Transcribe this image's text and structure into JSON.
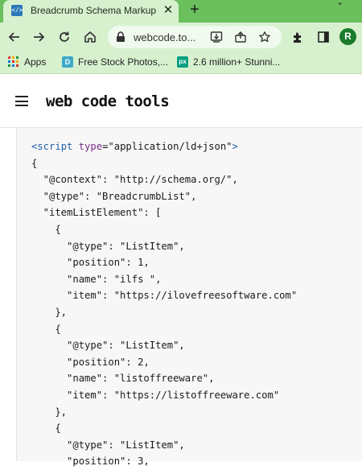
{
  "browser": {
    "tab": {
      "title": "Breadcrumb Schema Markup",
      "favicon_text": "</>"
    },
    "new_tab_label": "+",
    "url": "webcode.to...",
    "avatar_letter": "R",
    "bookmarks": [
      {
        "label": "Apps",
        "icon": "apps-grid-icon"
      },
      {
        "label": "Free Stock Photos,...",
        "icon": "stock-photos-icon"
      },
      {
        "label": "2.6 million+ Stunni...",
        "icon": "pexels-icon"
      }
    ]
  },
  "site": {
    "logo": "web code tools"
  },
  "code": {
    "script_open_tag": "script",
    "script_attr_name": "type",
    "script_attr_value": "\"application/ld+json\"",
    "lines": [
      "{",
      "  \"@context\": \"http://schema.org/\",",
      "  \"@type\": \"BreadcrumbList\",",
      "  \"itemListElement\": [",
      "    {",
      "      \"@type\": \"ListItem\",",
      "      \"position\": 1,",
      "      \"name\": \"ilfs \",",
      "      \"item\": \"https://ilovefreesoftware.com\"",
      "    },",
      "    {",
      "      \"@type\": \"ListItem\",",
      "      \"position\": 2,",
      "      \"name\": \"listoffreeware\",",
      "      \"item\": \"https://listoffreeware.com\"",
      "    },",
      "    {",
      "      \"@type\": \"ListItem\",",
      "      \"position\": 3,"
    ]
  },
  "colors": {
    "browser_frame": "#6bbf5d",
    "toolbar": "#d7f1cf",
    "code_background": "#f7f7f7",
    "tag_color": "#1f5fa8"
  }
}
